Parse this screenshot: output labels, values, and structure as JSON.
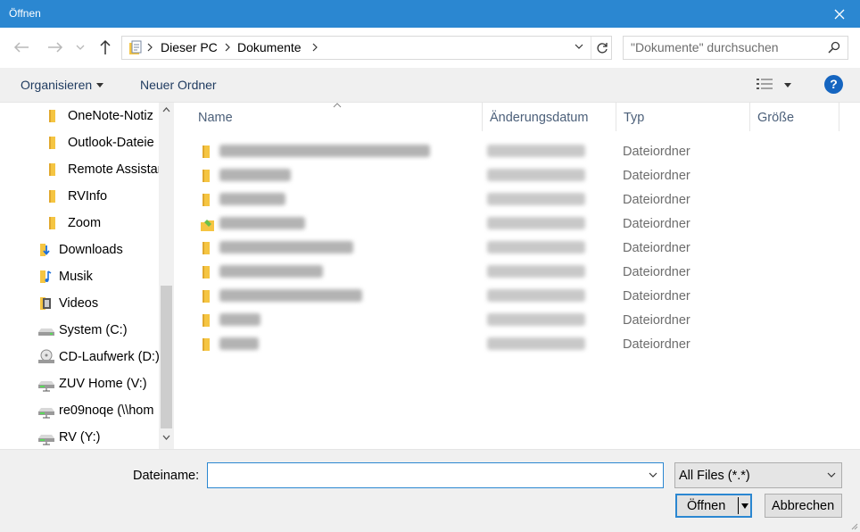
{
  "window": {
    "title": "Öffnen"
  },
  "nav": {
    "back_icon": "arrow-left-icon",
    "forward_icon": "arrow-right-icon",
    "recent_icon": "chevron-down-icon",
    "up_icon": "arrow-up-icon"
  },
  "address": {
    "crumbs": [
      "Dieser PC",
      "Dokumente"
    ]
  },
  "search": {
    "placeholder": "\"Dokumente\" durchsuchen"
  },
  "toolbar": {
    "organize_label": "Organisieren",
    "new_folder_label": "Neuer Ordner"
  },
  "sidebar": {
    "items": [
      {
        "label": "OneNote-Notiz",
        "icon": "folder-icon"
      },
      {
        "label": "Outlook-Dateie",
        "icon": "folder-icon"
      },
      {
        "label": "Remote Assistar",
        "icon": "folder-icon"
      },
      {
        "label": "RVInfo",
        "icon": "folder-icon"
      },
      {
        "label": "Zoom",
        "icon": "folder-icon"
      },
      {
        "label": "Downloads",
        "icon": "downloads-icon"
      },
      {
        "label": "Musik",
        "icon": "music-icon"
      },
      {
        "label": "Videos",
        "icon": "videos-icon"
      },
      {
        "label": "System (C:)",
        "icon": "drive-icon"
      },
      {
        "label": "CD-Laufwerk (D:)",
        "icon": "cd-drive-icon"
      },
      {
        "label": "ZUV Home (V:)",
        "icon": "network-drive-icon"
      },
      {
        "label": "re09noqe (\\\\hom",
        "icon": "network-drive-icon"
      },
      {
        "label": "RV (Y:)",
        "icon": "network-drive-icon"
      }
    ]
  },
  "columns": {
    "name": "Name",
    "date": "Änderungsdatum",
    "type": "Typ",
    "size": "Größe"
  },
  "files": [
    {
      "type": "Dateiordner",
      "icon": "folder-icon"
    },
    {
      "type": "Dateiordner",
      "icon": "folder-icon"
    },
    {
      "type": "Dateiordner",
      "icon": "folder-icon"
    },
    {
      "type": "Dateiordner",
      "icon": "special-folder-icon"
    },
    {
      "type": "Dateiordner",
      "icon": "folder-icon"
    },
    {
      "type": "Dateiordner",
      "icon": "folder-icon"
    },
    {
      "type": "Dateiordner",
      "icon": "folder-icon"
    },
    {
      "type": "Dateiordner",
      "icon": "folder-icon"
    },
    {
      "type": "Dateiordner",
      "icon": "folder-icon"
    }
  ],
  "bottom": {
    "filename_label": "Dateiname:",
    "filename_value": "",
    "filter_value": "All Files (*.*)",
    "open_label": "Öffnen",
    "cancel_label": "Abbrechen"
  },
  "colors": {
    "accent": "#2b87d1",
    "folder": "#f5c542",
    "help": "#1565c0"
  }
}
